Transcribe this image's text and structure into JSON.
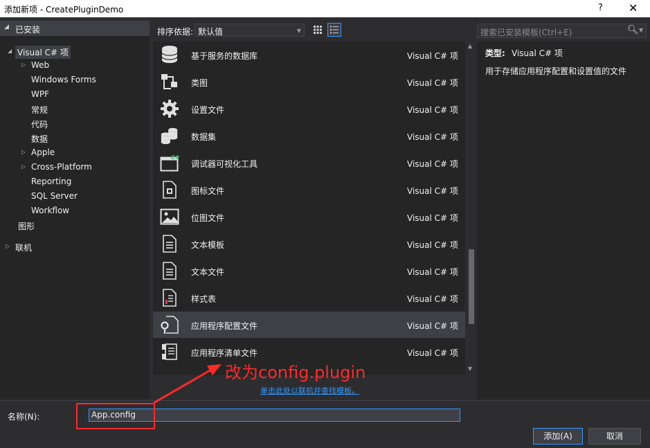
{
  "window": {
    "title": "添加新项 - CreatePluginDemo",
    "help": "?",
    "close": "✕"
  },
  "sidebar": {
    "installed_label": "已安装",
    "items": [
      {
        "label": "Visual C# 项",
        "expanded": true,
        "selected": true
      },
      {
        "label": "Web",
        "collapsed": true
      },
      {
        "label": "Windows Forms"
      },
      {
        "label": "WPF"
      },
      {
        "label": "常规"
      },
      {
        "label": "代码"
      },
      {
        "label": "数据"
      },
      {
        "label": "Apple",
        "collapsed": true
      },
      {
        "label": "Cross-Platform",
        "collapsed": true
      },
      {
        "label": "Reporting"
      },
      {
        "label": "SQL Server"
      },
      {
        "label": "Workflow"
      },
      {
        "label": "图形"
      }
    ],
    "online_label": "联机"
  },
  "toolbar": {
    "sort_label": "排序依据:",
    "sort_value": "默认值"
  },
  "search": {
    "placeholder": "搜索已安装模板(Ctrl+E)"
  },
  "templates": [
    {
      "name": "基于服务的数据库",
      "type": "Visual C# 项",
      "icon": "database-icon"
    },
    {
      "name": "类图",
      "type": "Visual C# 项",
      "icon": "class-diagram-icon"
    },
    {
      "name": "设置文件",
      "type": "Visual C# 项",
      "icon": "gear-icon"
    },
    {
      "name": "数据集",
      "type": "Visual C# 项",
      "icon": "dataset-icon"
    },
    {
      "name": "调试器可视化工具",
      "type": "Visual C# 项",
      "icon": "debugger-visualizer-icon"
    },
    {
      "name": "图标文件",
      "type": "Visual C# 项",
      "icon": "icon-file-icon"
    },
    {
      "name": "位图文件",
      "type": "Visual C# 项",
      "icon": "bitmap-icon"
    },
    {
      "name": "文本模板",
      "type": "Visual C# 项",
      "icon": "text-template-icon"
    },
    {
      "name": "文本文件",
      "type": "Visual C# 项",
      "icon": "text-file-icon"
    },
    {
      "name": "样式表",
      "type": "Visual C# 项",
      "icon": "stylesheet-icon"
    },
    {
      "name": "应用程序配置文件",
      "type": "Visual C# 项",
      "icon": "app-config-icon",
      "selected": true
    },
    {
      "name": "应用程序清单文件",
      "type": "Visual C# 项",
      "icon": "manifest-icon"
    }
  ],
  "details": {
    "type_label": "类型:",
    "type_value": "Visual C# 项",
    "description": "用于存储应用程序配置和设置值的文件"
  },
  "online_link": "单击此处以联机并查找模板。",
  "annotation": "改为config.plugin",
  "footer": {
    "name_label": "名称(N):",
    "name_value": "App.config",
    "add_button": "添加(A)",
    "cancel_button": "取消"
  },
  "colors": {
    "accent": "#3399ff",
    "annotation": "#ff2a2a",
    "background": "#2d2d30"
  }
}
